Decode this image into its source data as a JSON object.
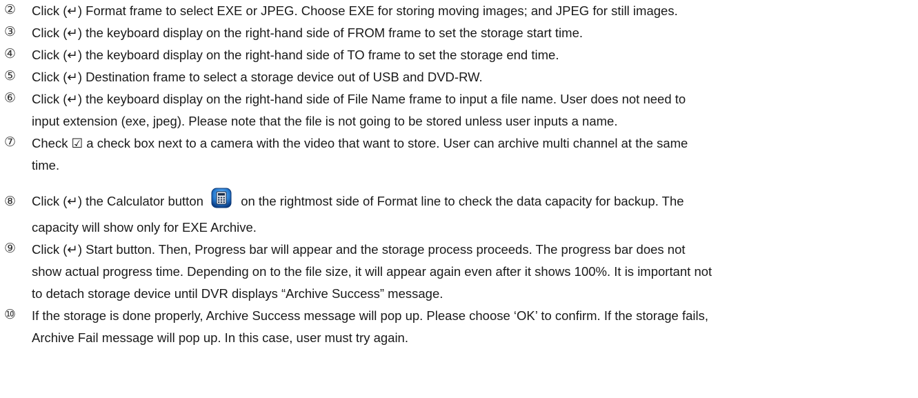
{
  "steps": [
    {
      "num": "②",
      "lines": [
        "Click (↵) Format frame to select EXE or JPEG. Choose EXE for storing moving images; and JPEG for still images."
      ]
    },
    {
      "num": "③",
      "lines": [
        "Click (↵) the keyboard display on the right-hand side of FROM frame to set the storage start time."
      ]
    },
    {
      "num": "④",
      "lines": [
        "Click (↵) the keyboard display on the right-hand side of TO frame to set the storage end time."
      ]
    },
    {
      "num": "⑤",
      "lines": [
        "Click (↵) Destination frame to select a storage device out of USB and DVD-RW."
      ]
    },
    {
      "num": "⑥",
      "lines": [
        "Click (↵) the keyboard display on the right-hand side of File Name frame to input a file name. User does not need to",
        "input extension (exe, jpeg). Please note that the file is not going to be stored unless user inputs a name."
      ]
    },
    {
      "num": "⑦",
      "lines": [
        "Check ☑ a check box next to a camera with the video that want to store. User can archive multi channel at the same",
        "time."
      ]
    },
    {
      "num": "⑧",
      "before_icon": "Click (↵) the Calculator button",
      "icon": "calculator-icon",
      "after_icon": "on the rightmost side of Format line to check the data capacity for backup. The",
      "lines_rest": [
        "capacity will show only for EXE Archive."
      ]
    },
    {
      "num": "⑨",
      "lines": [
        "Click (↵) Start button. Then, Progress bar will appear and the storage process proceeds. The progress bar does not",
        "show actual progress time. Depending on to the file size, it will appear again even after it shows 100%. It is important not",
        "to detach storage device until DVR displays “Archive Success” message."
      ]
    },
    {
      "num": "⑩",
      "lines": [
        "If the storage is done properly, Archive Success message will pop up. Please choose ‘OK’ to confirm. If the storage fails,",
        "Archive Fail message will pop up. In this case, user must try again."
      ]
    }
  ]
}
